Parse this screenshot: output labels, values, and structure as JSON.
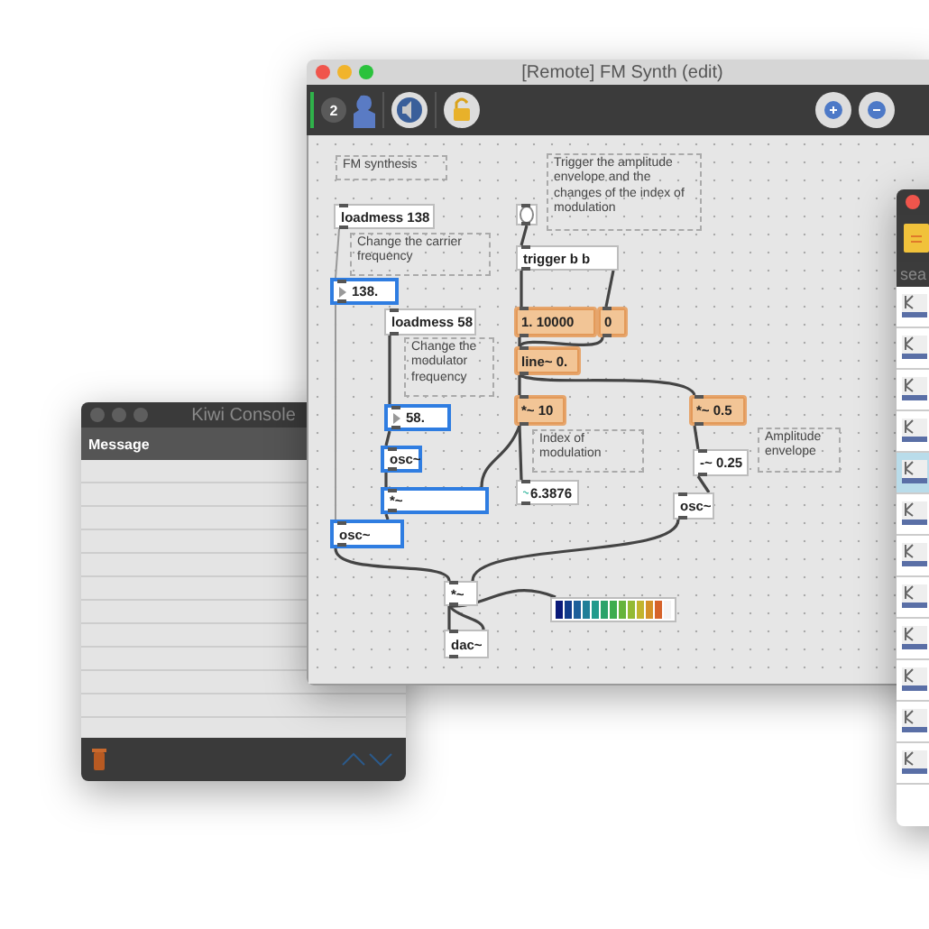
{
  "console_window": {
    "title": "Kiwi Console",
    "column": "Message"
  },
  "patcher_window": {
    "title": "[Remote] FM Synth (edit)",
    "toolbar": {
      "users_badge": "2"
    },
    "nodes": [
      {
        "kind": "comment",
        "text": "FM synthesis",
        "selected": false,
        "highlighted": false
      },
      {
        "kind": "comment",
        "text": "Trigger the amplitude envelope and the changes of the index of modulation",
        "selected": false,
        "highlighted": false
      },
      {
        "kind": "object",
        "text": "loadmess 138",
        "selected": false,
        "highlighted": false
      },
      {
        "kind": "bang",
        "selected": false,
        "highlighted": false
      },
      {
        "kind": "comment",
        "text": "Change the carrier frequency",
        "selected": false,
        "highlighted": false
      },
      {
        "kind": "object",
        "text": "trigger b b",
        "selected": false,
        "highlighted": false
      },
      {
        "kind": "number",
        "text": "138.",
        "selected": true,
        "highlighted": false
      },
      {
        "kind": "object",
        "text": "loadmess 58",
        "selected": false,
        "highlighted": false
      },
      {
        "kind": "message",
        "text": "1. 10000",
        "selected": false,
        "highlighted": true
      },
      {
        "kind": "message",
        "text": "0",
        "selected": false,
        "highlighted": true
      },
      {
        "kind": "comment",
        "text": "Change the modulator frequency",
        "selected": false,
        "highlighted": false
      },
      {
        "kind": "object",
        "text": "line~ 0.",
        "selected": false,
        "highlighted": true
      },
      {
        "kind": "number",
        "text": "58.",
        "selected": true,
        "highlighted": false
      },
      {
        "kind": "object",
        "text": "*~ 10",
        "selected": false,
        "highlighted": true
      },
      {
        "kind": "object",
        "text": "*~ 0.5",
        "selected": false,
        "highlighted": true
      },
      {
        "kind": "comment",
        "text": "Index of modulation",
        "selected": false,
        "highlighted": false
      },
      {
        "kind": "comment",
        "text": "Amplitude envelope",
        "selected": false,
        "highlighted": false
      },
      {
        "kind": "object",
        "text": "osc~",
        "selected": true,
        "highlighted": false
      },
      {
        "kind": "object",
        "text": "-~ 0.25",
        "selected": false,
        "highlighted": false
      },
      {
        "kind": "object",
        "text": "*~",
        "selected": true,
        "highlighted": false
      },
      {
        "kind": "signal",
        "text": "6.3876",
        "selected": false,
        "highlighted": false
      },
      {
        "kind": "object",
        "text": "osc~",
        "selected": false,
        "highlighted": false
      },
      {
        "kind": "object",
        "text": "osc~",
        "selected": true,
        "highlighted": false
      },
      {
        "kind": "object",
        "text": "*~",
        "selected": false,
        "highlighted": false
      },
      {
        "kind": "meter",
        "level": 0.92,
        "selected": false,
        "highlighted": false
      },
      {
        "kind": "object",
        "text": "dac~",
        "selected": false,
        "highlighted": false
      }
    ]
  },
  "browser_window": {
    "search": {
      "placeholder": "sea"
    },
    "rows": [
      {
        "selected": false
      },
      {
        "selected": false
      },
      {
        "selected": false
      },
      {
        "selected": false
      },
      {
        "selected": true
      },
      {
        "selected": false
      },
      {
        "selected": false
      },
      {
        "selected": false
      },
      {
        "selected": false
      },
      {
        "selected": false
      },
      {
        "selected": false
      },
      {
        "selected": false
      }
    ]
  }
}
